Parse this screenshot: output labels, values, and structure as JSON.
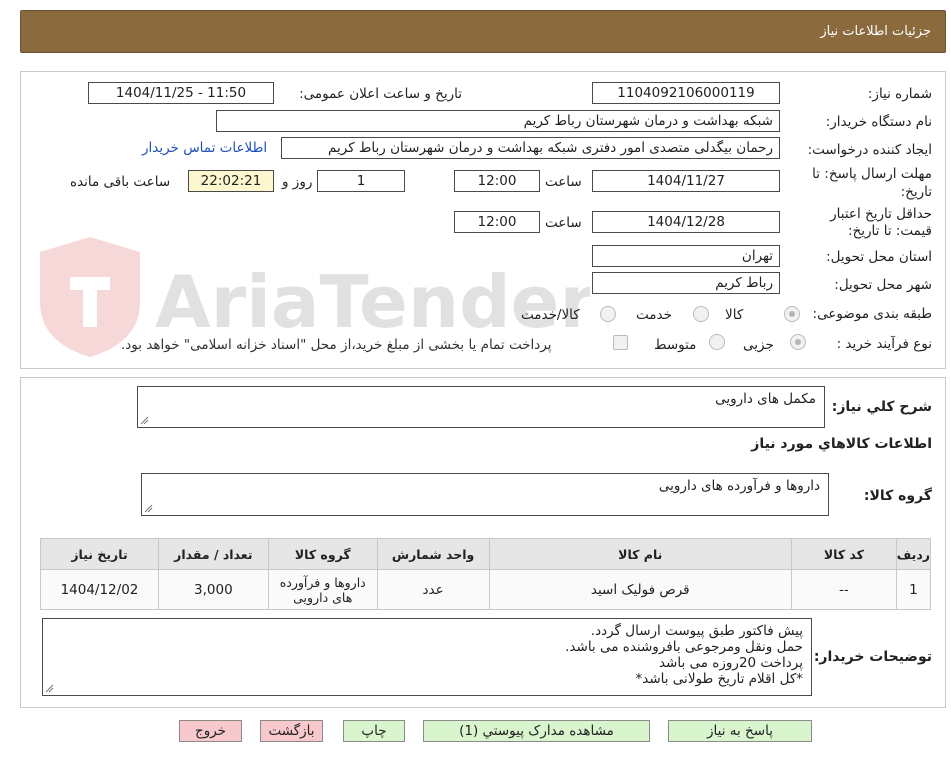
{
  "header": {
    "title": "جزئیات اطلاعات نیاز"
  },
  "watermark": {
    "text": "AriaTender.neT"
  },
  "fields": {
    "need_number_label": "شماره نیاز:",
    "need_number": "1104092106000119",
    "announce_label": "تاریخ و ساعت اعلان عمومی:",
    "announce_value": "1404/11/25 - 11:50",
    "buyer_org_label": "نام دستگاه خریدار:",
    "buyer_org": "شبکه بهداشت و درمان شهرستان رباط کریم",
    "creator_label": "ایجاد کننده درخواست:",
    "creator": "رحمان بیگدلی متصدی امور دفتری شبکه بهداشت و درمان شهرستان رباط کریم",
    "contact_link": "اطلاعات تماس خریدار",
    "deadline_label_1": "مهلت ارسال پاسخ: تا",
    "deadline_label_2": "تاریخ:",
    "deadline_date": "1404/11/27",
    "time_label": "ساعت",
    "deadline_time": "12:00",
    "days_value": "1",
    "days_label": "روز و",
    "remaining_time": "22:02:21",
    "remaining_label": "ساعت باقی مانده",
    "validity_label_1": "حداقل تاریخ اعتبار",
    "validity_label_2": "قیمت: تا تاریخ:",
    "validity_date": "1404/12/28",
    "validity_time": "12:00",
    "province_label": "استان محل تحویل:",
    "province": "تهران",
    "city_label": "شهر محل تحویل:",
    "city": "رباط کریم",
    "category_label": "طبقه بندی موضوعی:",
    "category_options": [
      "کالا",
      "خدمت",
      "کالا/خدمت"
    ],
    "category_selected": "کالا",
    "process_label": "نوع فرآیند خرید :",
    "process_options": [
      "جزیی",
      "متوسط"
    ],
    "process_selected": "جزیی",
    "payment_note": "پرداخت تمام یا بخشی از مبلغ خرید،از محل \"اسناد خزانه اسلامی\" خواهد بود."
  },
  "summary": {
    "label": "شرح کلي نياز:",
    "value": "مکمل های دارویی",
    "items_heading": "اطلاعات کالاهاي مورد نياز",
    "group_label": "گروه کالا:",
    "group_value": "داروها و فرآورده های دارویی"
  },
  "table": {
    "headers": [
      "رديف",
      "کد کالا",
      "نام کالا",
      "واحد شمارش",
      "گروه کالا",
      "تعداد / مقدار",
      "تاریخ نیاز"
    ],
    "rows": [
      [
        "1",
        "--",
        "قرص فولیک اسید",
        "عدد",
        "داروها و فرآورده های دارویی",
        "3,000",
        "1404/12/02"
      ]
    ]
  },
  "buyer_notes": {
    "label": "توضیحات خریدار:",
    "lines": [
      "پیش فاکتور طبق پیوست ارسال گردد.",
      "حمل ونقل ومرجوعی بافروشنده می باشد.",
      "پرداخت 20روزه می باشد",
      "*کل اقلام تاریخ طولانی باشد*"
    ]
  },
  "buttons": {
    "reply": "پاسخ به نیاز",
    "attachments": "مشاهده مدارک پیوستي (1)",
    "print": "چاپ",
    "back": "بازگشت",
    "exit": "خروج"
  },
  "colors": {
    "header_bg": "#8b6a3e",
    "link": "#1f4fbf",
    "green_button": "#d9f5cd",
    "pink_button": "#f8c9cc",
    "remaining_bg": "#fdf7cf"
  }
}
